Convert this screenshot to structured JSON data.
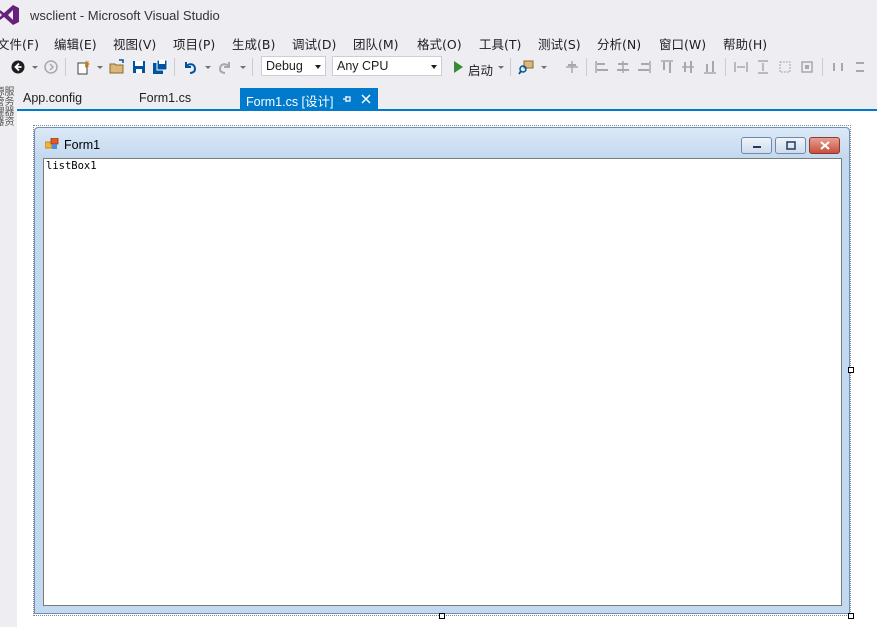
{
  "window": {
    "title": "wsclient - Microsoft Visual Studio"
  },
  "menu": {
    "items": [
      "文件(F)",
      "编辑(E)",
      "视图(V)",
      "项目(P)",
      "生成(B)",
      "调试(D)",
      "团队(M)",
      "格式(O)",
      "工具(T)",
      "测试(S)",
      "分析(N)",
      "窗口(W)",
      "帮助(H)"
    ]
  },
  "toolbar": {
    "config_value": "Debug",
    "platform_value": "Any CPU",
    "start_label": "启动"
  },
  "left_strip": {
    "text": "服务器资源管理器"
  },
  "tabs": [
    {
      "label": "App.config",
      "active": false
    },
    {
      "label": "Form1.cs",
      "active": false
    },
    {
      "label": "Form1.cs [设计]",
      "active": true
    }
  ],
  "form": {
    "title": "Form1",
    "listbox_label": "listBox1"
  },
  "colors": {
    "accent": "#007acc",
    "vs_purple": "#68217a",
    "start_green": "#388a34"
  }
}
